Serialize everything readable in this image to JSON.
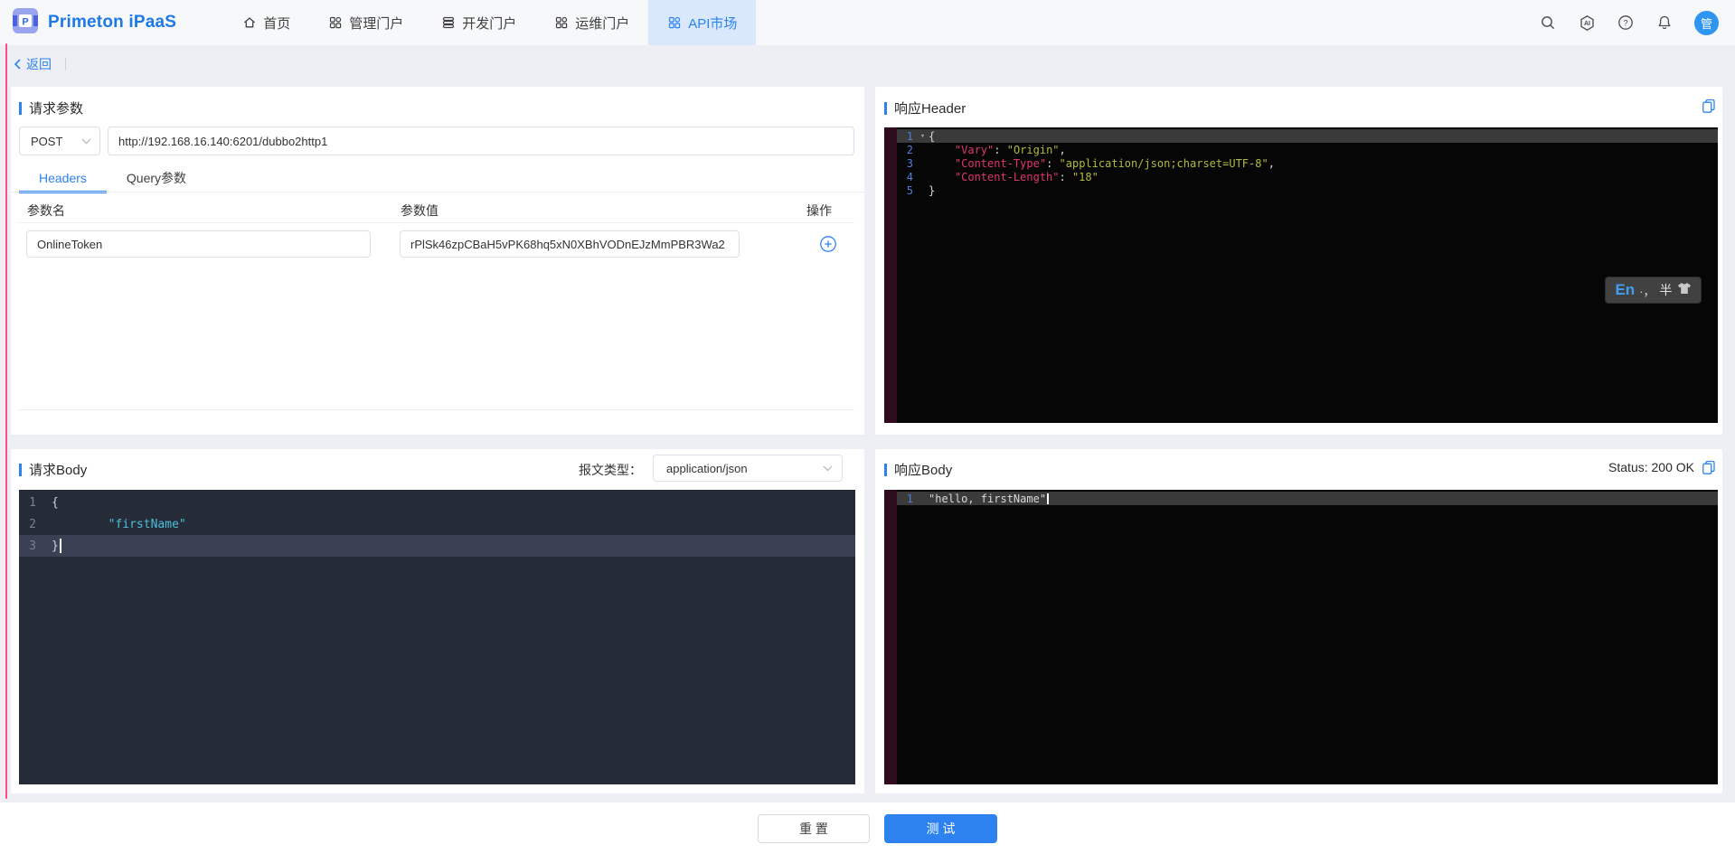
{
  "colors": {
    "accent": "#2e82f0",
    "active_tab_bg": "#d9e8fa",
    "editor_key": "#e0366e",
    "editor_value": "#b2ba40",
    "editor_string": "#49c0dc",
    "avatar_bg": "#2e95f0"
  },
  "nav": {
    "brand": "Primeton iPaaS",
    "items": [
      {
        "label": "首页",
        "active": false
      },
      {
        "label": "管理门户",
        "active": false
      },
      {
        "label": "开发门户",
        "active": false
      },
      {
        "label": "运维门户",
        "active": false
      },
      {
        "label": "API市场",
        "active": true
      }
    ],
    "avatar_text": "管"
  },
  "back_label": "返回",
  "request_panel": {
    "title": "请求参数",
    "method": "POST",
    "url": "http://192.168.16.140:6201/dubbo2http1",
    "tabs": [
      {
        "label": "Headers"
      },
      {
        "label": "Query参数"
      }
    ],
    "table": {
      "headers": [
        "参数名",
        "参数值",
        "操作"
      ],
      "rows": [
        {
          "name": "OnlineToken",
          "value": "rPlSk46zpCBaH5vPK68hq5xN0XBhVODnEJzMmPBR3Wa2"
        }
      ]
    }
  },
  "response_header_panel": {
    "title": "响应Header",
    "lines": [
      {
        "n": "1",
        "fold": true,
        "active": true,
        "tokens": [
          [
            "p",
            "{"
          ]
        ]
      },
      {
        "n": "2",
        "tokens": [
          [
            "p",
            "    "
          ],
          [
            "k",
            "\"Vary\""
          ],
          [
            "p",
            ": "
          ],
          [
            "v",
            "\"Origin\""
          ],
          [
            "p",
            ","
          ]
        ]
      },
      {
        "n": "3",
        "tokens": [
          [
            "p",
            "    "
          ],
          [
            "k",
            "\"Content-Type\""
          ],
          [
            "p",
            ": "
          ],
          [
            "v",
            "\"application/json;charset=UTF-8\""
          ],
          [
            "p",
            ","
          ]
        ]
      },
      {
        "n": "4",
        "tokens": [
          [
            "p",
            "    "
          ],
          [
            "k",
            "\"Content-Length\""
          ],
          [
            "p",
            ": "
          ],
          [
            "v",
            "\"18\""
          ]
        ]
      },
      {
        "n": "5",
        "tokens": [
          [
            "p",
            "}"
          ]
        ]
      }
    ],
    "ime": {
      "en": "En",
      "marks": "·，",
      "half": "半"
    }
  },
  "request_body_panel": {
    "title": "请求Body",
    "content_type_label": "报文类型：",
    "content_type": "application/json",
    "lines": [
      {
        "n": "1",
        "tokens": [
          [
            "p",
            "{"
          ]
        ]
      },
      {
        "n": "2",
        "tokens": [
          [
            "p",
            "        "
          ],
          [
            "s",
            "\"firstName\""
          ]
        ]
      },
      {
        "n": "3",
        "active": true,
        "cursor": true,
        "tokens": [
          [
            "p",
            "}"
          ]
        ]
      }
    ]
  },
  "response_body_panel": {
    "title": "响应Body",
    "status": "Status: 200 OK",
    "lines": [
      {
        "n": "1",
        "active": true,
        "cursor": true,
        "tokens": [
          [
            "p",
            "\"hello, firstName\""
          ]
        ]
      }
    ]
  },
  "footer": {
    "reset_label": "重 置",
    "test_label": "测 试"
  }
}
